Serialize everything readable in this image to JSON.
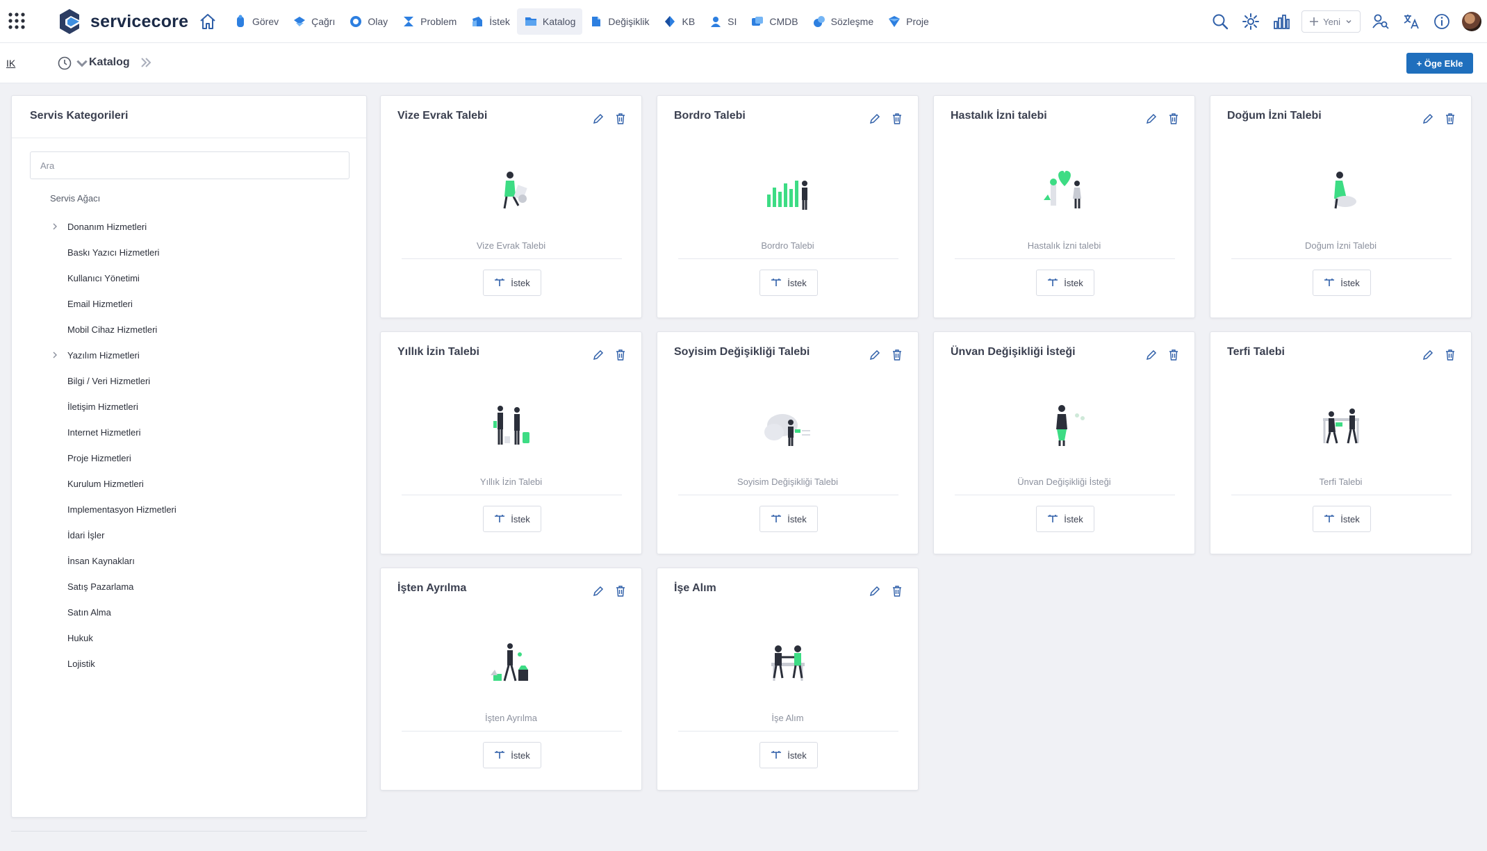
{
  "app": {
    "brand": "servicecore",
    "nav": [
      {
        "label": "Görev",
        "icon": "task-icon"
      },
      {
        "label": "Çağrı",
        "icon": "call-icon"
      },
      {
        "label": "Olay",
        "icon": "incident-icon"
      },
      {
        "label": "Problem",
        "icon": "problem-icon"
      },
      {
        "label": "İstek",
        "icon": "request-icon"
      },
      {
        "label": "Katalog",
        "icon": "catalog-icon",
        "active": true
      },
      {
        "label": "Değişiklik",
        "icon": "change-icon"
      },
      {
        "label": "KB",
        "icon": "knowledge-base-icon"
      },
      {
        "label": "SI",
        "icon": "si-icon"
      },
      {
        "label": "CMDB",
        "icon": "cmdb-icon"
      },
      {
        "label": "Sözleşme",
        "icon": "contract-icon"
      },
      {
        "label": "Proje",
        "icon": "project-icon"
      }
    ],
    "new_button": "Yeni",
    "accent": "#1f6fbd"
  },
  "subheader": {
    "back_link": "IK",
    "breadcrumb": "Katalog",
    "add_button": "+ Öge Ekle"
  },
  "sidebar": {
    "title": "Servis Kategorileri",
    "search_placeholder": "Ara",
    "root": "Servis Ağacı",
    "items": [
      {
        "label": "Donanım Hizmetleri",
        "expandable": true
      },
      {
        "label": "Baskı Yazıcı Hizmetleri",
        "expandable": false
      },
      {
        "label": "Kullanıcı Yönetimi",
        "expandable": false
      },
      {
        "label": "Email Hizmetleri",
        "expandable": false
      },
      {
        "label": "Mobil Cihaz Hizmetleri",
        "expandable": false
      },
      {
        "label": "Yazılım Hizmetleri",
        "expandable": true
      },
      {
        "label": "Bilgi / Veri Hizmetleri",
        "expandable": false
      },
      {
        "label": "İletişim Hizmetleri",
        "expandable": false
      },
      {
        "label": "Internet Hizmetleri",
        "expandable": false
      },
      {
        "label": "Proje Hizmetleri",
        "expandable": false
      },
      {
        "label": "Kurulum Hizmetleri",
        "expandable": false
      },
      {
        "label": "Implementasyon Hizmetleri",
        "expandable": false
      },
      {
        "label": "İdari İşler",
        "expandable": false
      },
      {
        "label": "İnsan Kaynakları",
        "expandable": false
      },
      {
        "label": "Satış Pazarlama",
        "expandable": false
      },
      {
        "label": "Satın Alma",
        "expandable": false
      },
      {
        "label": "Hukuk",
        "expandable": false
      },
      {
        "label": "Lojistik",
        "expandable": false
      }
    ]
  },
  "cards": [
    {
      "title": "Vize Evrak Talebi",
      "subtitle": "Vize Evrak Talebi",
      "button": "İstek",
      "illustration": "document-person-illustration"
    },
    {
      "title": "Bordro Talebi",
      "subtitle": "Bordro Talebi",
      "button": "İstek",
      "illustration": "bar-chart-person-illustration"
    },
    {
      "title": "Hastalık İzni talebi",
      "subtitle": "Hastalık İzni talebi",
      "button": "İstek",
      "illustration": "heart-people-illustration"
    },
    {
      "title": "Doğum İzni Talebi",
      "subtitle": "Doğum İzni Talebi",
      "button": "İstek",
      "illustration": "sitting-person-illustration"
    },
    {
      "title": "Yıllık İzin Talebi",
      "subtitle": "Yıllık İzin Talebi",
      "button": "İstek",
      "illustration": "travelers-illustration"
    },
    {
      "title": "Soyisim Değişikliği Talebi",
      "subtitle": "Soyisim Değişikliği Talebi",
      "button": "İstek",
      "illustration": "cloud-person-illustration"
    },
    {
      "title": "Ünvan Değişikliği İsteği",
      "subtitle": "Ünvan Değişikliği İsteği",
      "button": "İstek",
      "illustration": "standing-woman-illustration"
    },
    {
      "title": "Terfi Talebi",
      "subtitle": "Terfi Talebi",
      "button": "İstek",
      "illustration": "meeting-illustration"
    },
    {
      "title": "İşten Ayrılma",
      "subtitle": "İşten Ayrılma",
      "button": "İstek",
      "illustration": "leaving-person-illustration"
    },
    {
      "title": "İşe Alım",
      "subtitle": "İşe Alım",
      "button": "İstek",
      "illustration": "handshake-illustration"
    }
  ]
}
